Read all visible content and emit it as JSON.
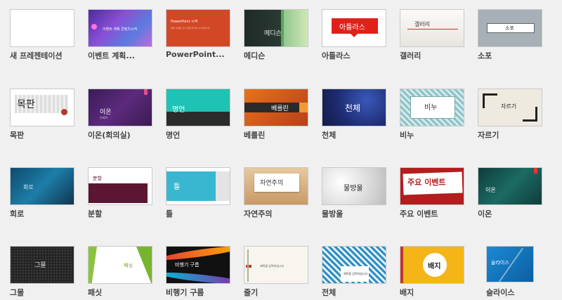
{
  "themes": [
    {
      "name": "새 프레젠테이션"
    },
    {
      "name": "이벤트 계획...",
      "thumb": "이벤트 계획 콘텐츠시작"
    },
    {
      "name": "PowerPoint...",
      "thumb": "PowerPoint 시작",
      "sub": "방법: 이벤트 추가 항목 추가하시기 바랍니다"
    },
    {
      "name": "메디슨",
      "thumb": "메디슨"
    },
    {
      "name": "아틀라스",
      "thumb": "아틀라스"
    },
    {
      "name": "갤러리",
      "thumb": "갤러리"
    },
    {
      "name": "소포",
      "thumb": "소포"
    },
    {
      "name": "목판",
      "thumb": "목판"
    },
    {
      "name": "이온(회의실)",
      "thumb": "이온",
      "sub": "부제목"
    },
    {
      "name": "명언",
      "thumb": "명언"
    },
    {
      "name": "베를린",
      "thumb": "베를린"
    },
    {
      "name": "천체",
      "thumb": "천체"
    },
    {
      "name": "비누",
      "thumb": "비누"
    },
    {
      "name": "자르기",
      "thumb": "자르기"
    },
    {
      "name": "회로",
      "thumb": "회로"
    },
    {
      "name": "분할",
      "thumb": "분할"
    },
    {
      "name": "틀",
      "thumb": "틀"
    },
    {
      "name": "자연주의",
      "thumb": "자연주의"
    },
    {
      "name": "물방울",
      "thumb": "물방울"
    },
    {
      "name": "주요 이벤트",
      "thumb": "주요 이벤트"
    },
    {
      "name": "이온",
      "thumb": "이온"
    },
    {
      "name": "그물",
      "thumb": "그물"
    },
    {
      "name": "패싯",
      "thumb": "패싯"
    },
    {
      "name": "비행기 구름",
      "thumb": "비행기 구름"
    },
    {
      "name": "줄기",
      "thumb": "제목을 입력하십시오"
    },
    {
      "name": "전체",
      "thumb": "제목을 입력하십시오"
    },
    {
      "name": "배지",
      "thumb": "배지"
    },
    {
      "name": "슬라이스",
      "thumb": "슬라이스"
    }
  ]
}
